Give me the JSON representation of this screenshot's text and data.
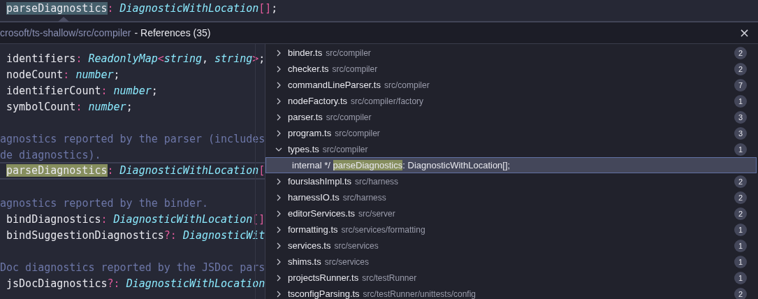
{
  "editor_line": [
    {
      "text": "parseDiagnostics",
      "kind": "hl"
    },
    {
      "text": ": ",
      "kind": "punct"
    },
    {
      "text": "DiagnosticWithLocation",
      "kind": "type"
    },
    {
      "text": "[]",
      "kind": "punct"
    },
    {
      "text": ";",
      "kind": "plain"
    }
  ],
  "peek": {
    "path": "crosoft/ts-shallow/src/compiler",
    "title": "- References (35)",
    "close": "×"
  },
  "preview_lines": [
    {
      "kind": "code",
      "selected": false,
      "tokens": [
        {
          "text": " identifiers",
          "kind": "plain"
        },
        {
          "text": ": ",
          "kind": "punct"
        },
        {
          "text": "ReadonlyMap",
          "kind": "type"
        },
        {
          "text": "<",
          "kind": "punct"
        },
        {
          "text": "string",
          "kind": "type"
        },
        {
          "text": ", ",
          "kind": "plain"
        },
        {
          "text": "string",
          "kind": "type"
        },
        {
          "text": ">",
          "kind": "punct"
        },
        {
          "text": ";",
          "kind": "plain"
        }
      ]
    },
    {
      "kind": "code",
      "selected": false,
      "tokens": [
        {
          "text": " nodeCount",
          "kind": "plain"
        },
        {
          "text": ": ",
          "kind": "punct"
        },
        {
          "text": "number",
          "kind": "type"
        },
        {
          "text": ";",
          "kind": "plain"
        }
      ]
    },
    {
      "kind": "code",
      "selected": false,
      "tokens": [
        {
          "text": " identifierCount",
          "kind": "plain"
        },
        {
          "text": ": ",
          "kind": "punct"
        },
        {
          "text": "number",
          "kind": "type"
        },
        {
          "text": ";",
          "kind": "plain"
        }
      ]
    },
    {
      "kind": "code",
      "selected": false,
      "tokens": [
        {
          "text": " symbolCount",
          "kind": "plain"
        },
        {
          "text": ": ",
          "kind": "punct"
        },
        {
          "text": "number",
          "kind": "type"
        },
        {
          "text": ";",
          "kind": "plain"
        }
      ]
    },
    {
      "kind": "blank"
    },
    {
      "kind": "code",
      "selected": false,
      "tokens": [
        {
          "text": "agnostics reported by the parser (includes",
          "kind": "comment"
        }
      ]
    },
    {
      "kind": "code",
      "selected": false,
      "tokens": [
        {
          "text": "de diagnostics).",
          "kind": "comment"
        }
      ]
    },
    {
      "kind": "code",
      "selected": true,
      "tokens": [
        {
          "text": "parseDiagnostics",
          "kind": "match"
        },
        {
          "text": ": ",
          "kind": "punct"
        },
        {
          "text": "DiagnosticWithLocation",
          "kind": "type"
        },
        {
          "text": "[",
          "kind": "punct"
        }
      ]
    },
    {
      "kind": "blank"
    },
    {
      "kind": "code",
      "selected": false,
      "tokens": [
        {
          "text": "agnostics reported by the binder.",
          "kind": "comment"
        }
      ]
    },
    {
      "kind": "code",
      "selected": false,
      "tokens": [
        {
          "text": " bindDiagnostics",
          "kind": "plain"
        },
        {
          "text": ": ",
          "kind": "punct"
        },
        {
          "text": "DiagnosticWithLocation",
          "kind": "type"
        },
        {
          "text": "[]",
          "kind": "punct"
        }
      ]
    },
    {
      "kind": "code",
      "selected": false,
      "tokens": [
        {
          "text": " bindSuggestionDiagnostics",
          "kind": "plain"
        },
        {
          "text": "?: ",
          "kind": "punct"
        },
        {
          "text": "DiagnosticWit",
          "kind": "type"
        }
      ]
    },
    {
      "kind": "blank"
    },
    {
      "kind": "code",
      "selected": false,
      "tokens": [
        {
          "text": "Doc diagnostics reported by the JSDoc pars",
          "kind": "comment"
        }
      ]
    },
    {
      "kind": "code",
      "selected": false,
      "tokens": [
        {
          "text": " jsDocDiagnostics",
          "kind": "plain"
        },
        {
          "text": "?: ",
          "kind": "punct"
        },
        {
          "text": "DiagnosticWithLocation",
          "kind": "type"
        }
      ]
    }
  ],
  "references": [
    {
      "file": "binder.ts",
      "path": "src/compiler",
      "count": "2",
      "expanded": false
    },
    {
      "file": "checker.ts",
      "path": "src/compiler",
      "count": "2",
      "expanded": false
    },
    {
      "file": "commandLineParser.ts",
      "path": "src/compiler",
      "count": "7",
      "expanded": false
    },
    {
      "file": "nodeFactory.ts",
      "path": "src/compiler/factory",
      "count": "1",
      "expanded": false
    },
    {
      "file": "parser.ts",
      "path": "src/compiler",
      "count": "3",
      "expanded": false
    },
    {
      "file": "program.ts",
      "path": "src/compiler",
      "count": "3",
      "expanded": false
    },
    {
      "file": "types.ts",
      "path": "src/compiler",
      "count": "1",
      "expanded": true,
      "children": [
        {
          "prefix": "internal */ ",
          "match": "parseDiagnostics",
          "suffix": ": DiagnosticWithLocation[];",
          "selected": true
        }
      ]
    },
    {
      "file": "fourslashImpl.ts",
      "path": "src/harness",
      "count": "2",
      "expanded": false
    },
    {
      "file": "harnessIO.ts",
      "path": "src/harness",
      "count": "2",
      "expanded": false
    },
    {
      "file": "editorServices.ts",
      "path": "src/server",
      "count": "2",
      "expanded": false
    },
    {
      "file": "formatting.ts",
      "path": "src/services/formatting",
      "count": "1",
      "expanded": false
    },
    {
      "file": "services.ts",
      "path": "src/services",
      "count": "1",
      "expanded": false
    },
    {
      "file": "shims.ts",
      "path": "src/services",
      "count": "1",
      "expanded": false
    },
    {
      "file": "projectsRunner.ts",
      "path": "src/testRunner",
      "count": "1",
      "expanded": false
    },
    {
      "file": "tsconfigParsing.ts",
      "path": "src/testRunner/unittests/config",
      "count": "2",
      "expanded": false
    }
  ]
}
